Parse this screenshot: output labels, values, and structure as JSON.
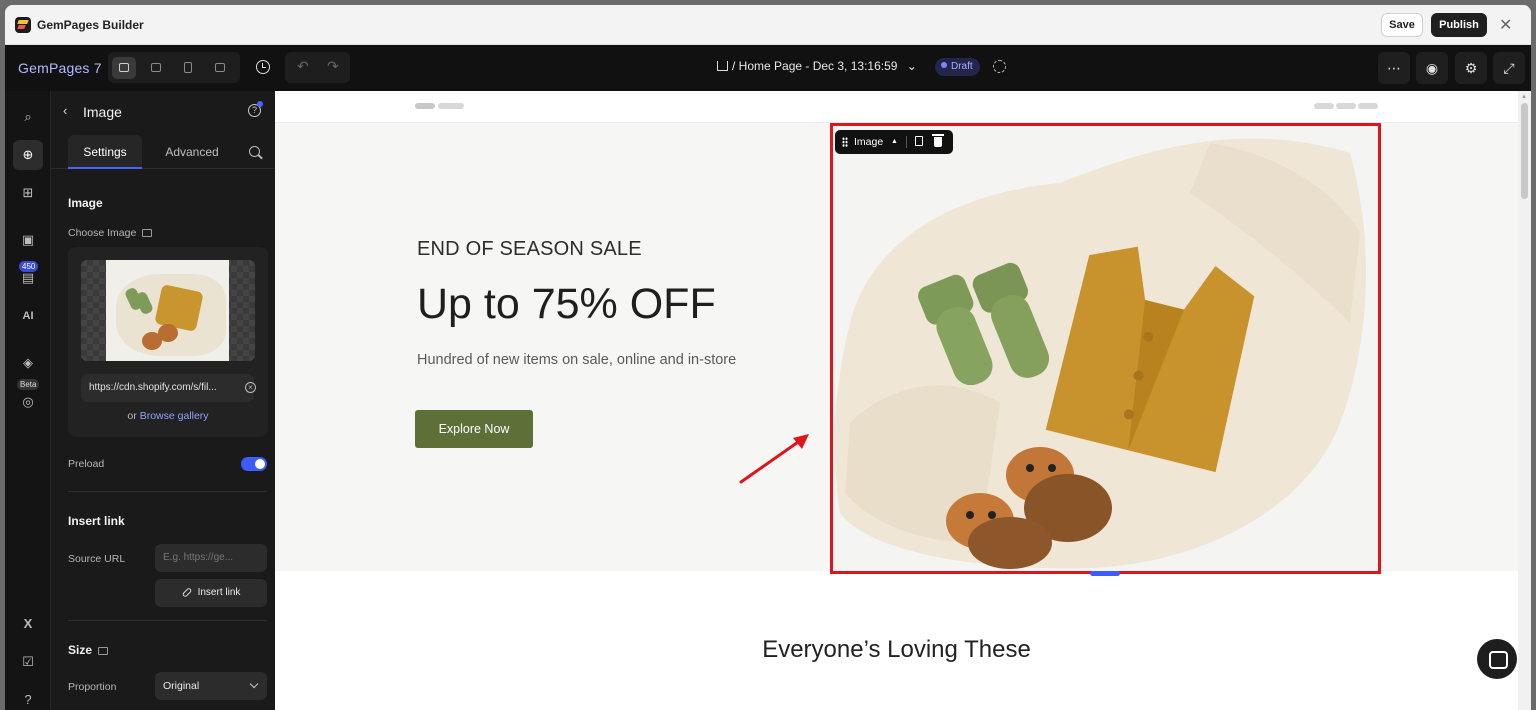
{
  "titlebar": {
    "app_title": "GemPages Builder",
    "save_label": "Save",
    "publish_label": "Publish",
    "close_glyph": "✕"
  },
  "toolbar": {
    "brand": "GemPages 7",
    "page_selector": "/ Home Page - Dec 3, 13:16:59",
    "page_caret": "⌄",
    "status_badge": "Draft",
    "more_glyph": "⋯",
    "undo_glyph": "↶",
    "redo_glyph": "↷",
    "preview_glyph": "◉",
    "settings_glyph": "⚙",
    "fullscreen_glyph": "⤢"
  },
  "rail": {
    "search_glyph": "⌕",
    "add_glyph": "⊕",
    "elements_glyph": "⊞",
    "pages_glyph": "▣",
    "library_count": "450",
    "library_glyph": "▤",
    "ai_glyph": "AI",
    "layers_glyph": "◈",
    "beta_label": "Beta",
    "beta_glyph": "◎",
    "apps_glyph": "X",
    "checklist_glyph": "☑",
    "help_glyph": "?"
  },
  "panel": {
    "back_glyph": "‹",
    "title": "Image",
    "help_glyph": "?",
    "tab_settings": "Settings",
    "tab_advanced": "Advanced",
    "image_section": "Image",
    "choose_image_label": "Choose Image",
    "image_url": "https://cdn.shopify.com/s/fil...",
    "clear_glyph": "×",
    "browse_prefix": "or",
    "browse_link": "Browse gallery",
    "preload_label": "Preload",
    "preload_on": true,
    "insert_link_section": "Insert link",
    "source_url_label": "Source URL",
    "source_url_placeholder": "E.g. https://ge...",
    "insert_link_button": "Insert link",
    "size_section": "Size",
    "proportion_label": "Proportion",
    "proportion_value": "Original"
  },
  "canvas": {
    "hero_eyebrow": "END OF SEASON SALE",
    "hero_title": "Up to 75% OFF",
    "hero_subtitle": "Hundred of new items on sale, online and in-store",
    "hero_button": "Explore Now",
    "image_toolbar_label": "Image",
    "image_toolbar_caret": "▲",
    "section_title": "Everyone’s Loving These"
  },
  "colors": {
    "accent": "#3d5cff",
    "hero_button": "#5d7037",
    "highlight_frame": "#e0151c",
    "draft": "#a9b0ff"
  }
}
